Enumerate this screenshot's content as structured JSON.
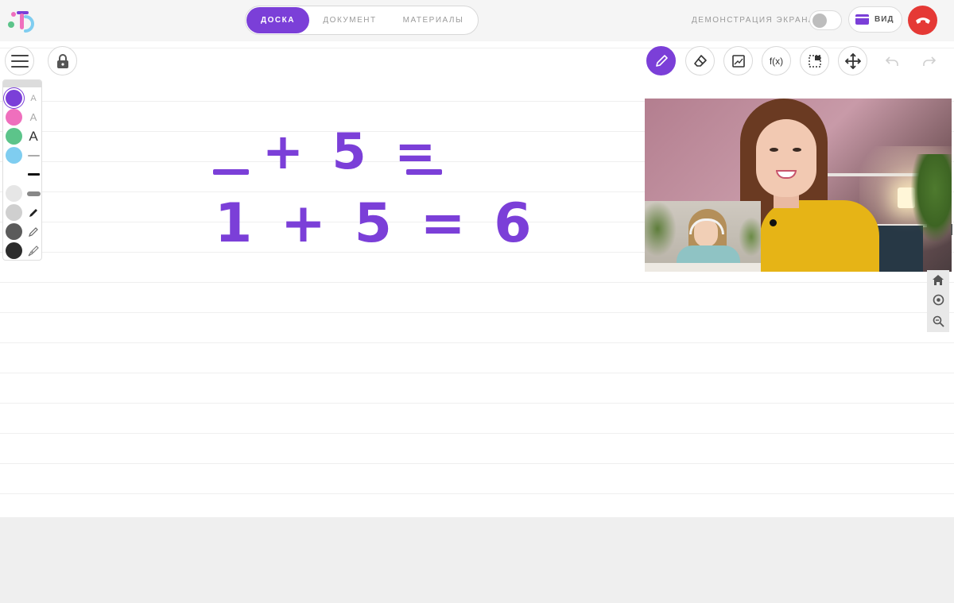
{
  "header": {
    "tabs": [
      {
        "label": "ДОСКА",
        "active": true
      },
      {
        "label": "ДОКУМЕНТ",
        "active": false
      },
      {
        "label": "МАТЕРИАЛЫ",
        "active": false
      }
    ],
    "screen_share_label": "ДЕМОНСТРАЦИЯ ЭКРАНА",
    "screen_share_on": false,
    "view_label": "ВИД"
  },
  "toolbar": {
    "tools": [
      "pencil-icon",
      "eraser-icon",
      "image-icon",
      "function-icon",
      "select-icon",
      "move-icon",
      "undo-icon",
      "redo-icon"
    ],
    "active_tool": "pencil-icon",
    "function_label": "f(x)"
  },
  "palette": {
    "colors": [
      "#7b3fd8",
      "#ef6fbd",
      "#5cc48a",
      "#7fcdf0",
      "#e6e6e6",
      "#cfcfcf",
      "#5b5b5b",
      "#2c2c2c"
    ],
    "selected_color": "#7b3fd8",
    "font_size_letters": [
      "A",
      "A",
      "A"
    ]
  },
  "board": {
    "equation1": "+ 5 =",
    "equation2": "1 + 5 = 6"
  },
  "colors": {
    "accent": "#7b3fd8",
    "hangup": "#e53935"
  }
}
